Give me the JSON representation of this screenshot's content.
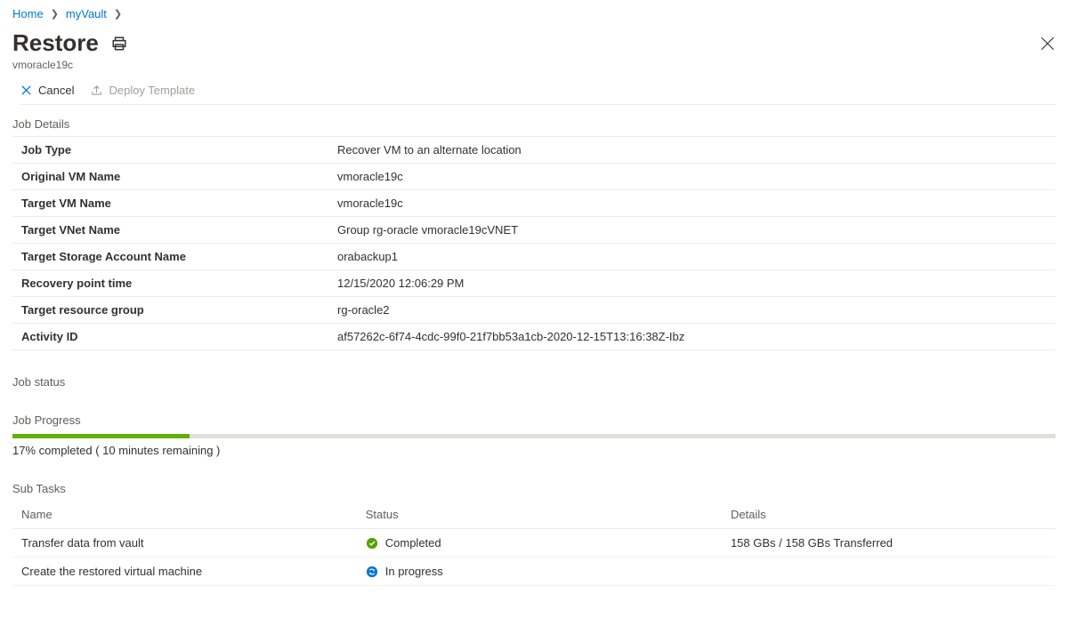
{
  "breadcrumb": {
    "home": "Home",
    "vault": "myVault"
  },
  "header": {
    "title": "Restore",
    "subtitle": "vmoracle19c"
  },
  "toolbar": {
    "cancel": "Cancel",
    "deploy": "Deploy Template"
  },
  "sections": {
    "jobDetails": "Job Details",
    "jobStatus": "Job status",
    "jobProgress": "Job Progress",
    "subTasks": "Sub Tasks"
  },
  "details": [
    {
      "key": "Job Type",
      "value": "Recover VM to an alternate location"
    },
    {
      "key": "Original VM Name",
      "value": "vmoracle19c"
    },
    {
      "key": "Target VM Name",
      "value": "vmoracle19c"
    },
    {
      "key": "Target VNet Name",
      "value": "Group rg-oracle vmoracle19cVNET"
    },
    {
      "key": "Target Storage Account Name",
      "value": "orabackup1"
    },
    {
      "key": "Recovery point time",
      "value": "12/15/2020 12:06:29 PM"
    },
    {
      "key": "Target resource group",
      "value": "rg-oracle2"
    },
    {
      "key": "Activity ID",
      "value": "af57262c-6f74-4cdc-99f0-21f7bb53a1cb-2020-12-15T13:16:38Z-Ibz"
    }
  ],
  "progress": {
    "percent": 17,
    "text": "17% completed ( 10 minutes remaining )"
  },
  "subtasks": {
    "columns": {
      "name": "Name",
      "status": "Status",
      "details": "Details"
    },
    "rows": [
      {
        "name": "Transfer data from vault",
        "status": "Completed",
        "statusType": "completed",
        "details": "158 GBs / 158 GBs Transferred"
      },
      {
        "name": "Create the restored virtual machine",
        "status": "In progress",
        "statusType": "inprogress",
        "details": ""
      }
    ]
  },
  "colors": {
    "link": "#0078d4",
    "progress": "#5db300",
    "success": "#57a300",
    "inprogress": "#0078d4"
  }
}
